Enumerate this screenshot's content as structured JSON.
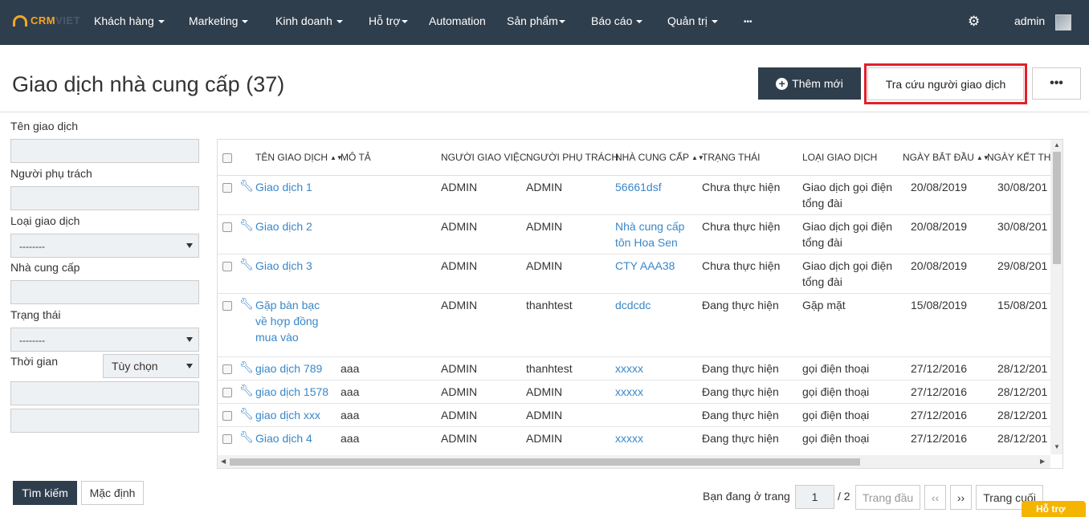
{
  "nav": {
    "logo_crm": "CRM",
    "logo_viet": "VIET",
    "items": [
      {
        "label": "Khách hàng",
        "caret": true
      },
      {
        "label": "Marketing",
        "caret": true
      },
      {
        "label": "Kinh doanh",
        "caret": true
      },
      {
        "label": "Hỗ trợ",
        "caret": true
      },
      {
        "label": "Automation",
        "caret": false
      },
      {
        "label": "Sản phẩm",
        "caret": true
      },
      {
        "label": "Báo cáo",
        "caret": true
      },
      {
        "label": "Quản trị",
        "caret": true
      },
      {
        "label": "•••",
        "caret": false
      }
    ],
    "user": "admin"
  },
  "page": {
    "title": "Giao dịch nhà cung cấp (37)",
    "add_button": "Thêm mới",
    "lookup_button": "Tra cứu người giao dịch",
    "more_button": "•••"
  },
  "filters": {
    "name_label": "Tên giao dịch",
    "owner_label": "Người phụ trách",
    "type_label": "Loại giao dịch",
    "type_value": "--------",
    "supplier_label": "Nhà cung cấp",
    "status_label": "Trạng thái",
    "status_value": "--------",
    "time_label": "Thời gian",
    "time_option": "Tùy chọn",
    "search_button": "Tìm kiếm",
    "default_button": "Mặc định"
  },
  "table": {
    "headers": {
      "name": "TÊN GIAO DỊCH",
      "desc": "MÔ TẢ",
      "assigner": "NGƯỜI GIAO VIỆC",
      "owner": "NGƯỜI PHỤ TRÁCH",
      "supplier": "NHÀ CUNG CẤP",
      "status": "TRẠNG THÁI",
      "type": "LOẠI GIAO DỊCH",
      "start": "NGÀY BẮT ĐẦU",
      "end": "NGÀY KẾT THÚ"
    },
    "rows": [
      {
        "name": "Giao dịch 1",
        "desc": "",
        "assigner": "ADMIN",
        "owner": "ADMIN",
        "supplier": "56661dsf",
        "status": "Chưa thực hiện",
        "type": "Giao dịch gọi điện tổng đài",
        "start": "20/08/2019",
        "end": "30/08/201"
      },
      {
        "name": "Giao dịch 2",
        "desc": "",
        "assigner": "ADMIN",
        "owner": "ADMIN",
        "supplier": "Nhà cung cấp tôn Hoa Sen",
        "status": "Chưa thực hiện",
        "type": "Giao dịch gọi điện tổng đài",
        "start": "20/08/2019",
        "end": "30/08/201"
      },
      {
        "name": "Giao dịch 3",
        "desc": "",
        "assigner": "ADMIN",
        "owner": "ADMIN",
        "supplier": "CTY AAA38",
        "status": "Chưa thực hiện",
        "type": "Giao dịch gọi điện tổng đài",
        "start": "20/08/2019",
        "end": "29/08/201"
      },
      {
        "name": "Gặp bàn bạc về hợp đồng mua vào",
        "desc": "",
        "assigner": "ADMIN",
        "owner": "thanhtest",
        "supplier": "dcdcdc",
        "status": "Đang thực hiện",
        "type": "Gặp mặt",
        "start": "15/08/2019",
        "end": "15/08/201"
      },
      {
        "name": "giao dịch 789",
        "desc": "aaa",
        "assigner": "ADMIN",
        "owner": "thanhtest",
        "supplier": "xxxxx",
        "status": "Đang thực hiện",
        "type": "gọi điện thoại",
        "start": "27/12/2016",
        "end": "28/12/201"
      },
      {
        "name": "giao dịch 1578",
        "desc": "aaa",
        "assigner": "ADMIN",
        "owner": "ADMIN",
        "supplier": "xxxxx",
        "status": "Đang thực hiện",
        "type": "gọi điện thoại",
        "start": "27/12/2016",
        "end": "28/12/201"
      },
      {
        "name": "giao dịch xxx",
        "desc": "aaa",
        "assigner": "ADMIN",
        "owner": "ADMIN",
        "supplier": "",
        "status": "Đang thực hiện",
        "type": "gọi điện thoại",
        "start": "27/12/2016",
        "end": "28/12/201"
      },
      {
        "name": "Giao dịch 4",
        "desc": "aaa",
        "assigner": "ADMIN",
        "owner": "ADMIN",
        "supplier": "xxxxx",
        "status": "Đang thực hiện",
        "type": "gọi điện thoại",
        "start": "27/12/2016",
        "end": "28/12/201"
      }
    ]
  },
  "pagination": {
    "label": "Bạn đang ở trang",
    "current": "1",
    "total": "/ 2",
    "first": "Trang đầu",
    "prev": "‹‹",
    "next": "››",
    "last": "Trang cuối"
  },
  "help_tab": "Hỗ trợ",
  "colors": {
    "nav_bg": "#2f3e4d",
    "link": "#3a87c8",
    "highlight": "#e0202a",
    "logo": "#f5a623"
  }
}
